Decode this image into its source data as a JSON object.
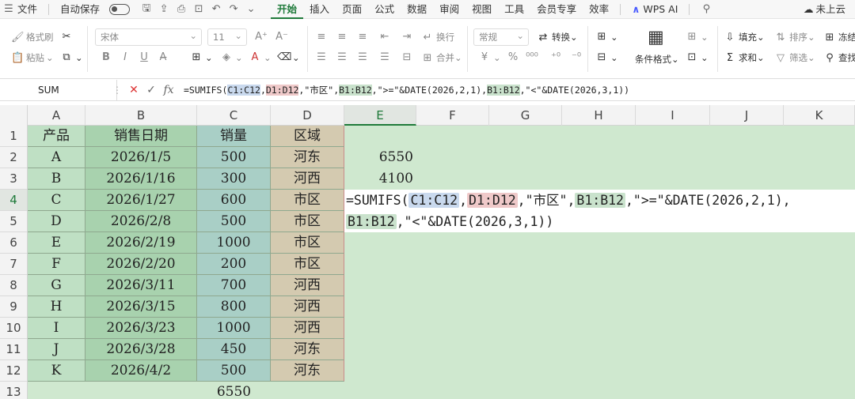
{
  "menubar": {
    "file": "文件",
    "autosave": "自动保存",
    "tabs": [
      "开始",
      "插入",
      "页面",
      "公式",
      "数据",
      "审阅",
      "视图",
      "工具",
      "会员专享",
      "效率"
    ],
    "active_tab": "开始",
    "wps_ai": "WPS AI",
    "cloud": "未上云"
  },
  "ribbon": {
    "format_painter": "格式刷",
    "paste": "粘贴",
    "font_name": "宋体",
    "font_size": "11",
    "wrap": "换行",
    "merge": "合并",
    "number_format": "常规",
    "convert": "转换",
    "conditional_format": "条件格式",
    "fill": "填充",
    "sort": "排序",
    "freeze": "冻结",
    "sum": "求和",
    "filter": "筛选",
    "find": "查找"
  },
  "formulabar": {
    "name_box": "SUM",
    "parts": [
      {
        "t": "=SUMIFS(",
        "c": ""
      },
      {
        "t": "C1:C12",
        "c": "r-c"
      },
      {
        "t": ",",
        "c": ""
      },
      {
        "t": "D1:D12",
        "c": "r-d"
      },
      {
        "t": ",\"市区\",",
        "c": ""
      },
      {
        "t": "B1:B12",
        "c": "r-b"
      },
      {
        "t": ",\">=\"&DATE(2026,2,1),",
        "c": ""
      },
      {
        "t": "B1:B12",
        "c": "r-b"
      },
      {
        "t": ",\"<\"&DATE(2026,3,1))",
        "c": ""
      }
    ]
  },
  "grid": {
    "columns": [
      "A",
      "B",
      "C",
      "D",
      "E",
      "F",
      "G",
      "H",
      "I",
      "J",
      "K"
    ],
    "rows": [
      "1",
      "2",
      "3",
      "4",
      "5",
      "6",
      "7",
      "8",
      "9",
      "10",
      "11",
      "12",
      "13"
    ],
    "header": [
      "产品",
      "销售日期",
      "销量",
      "区域"
    ],
    "data": [
      [
        "A",
        "2026/1/5",
        "500",
        "河东"
      ],
      [
        "B",
        "2026/1/16",
        "300",
        "河西"
      ],
      [
        "C",
        "2026/1/27",
        "600",
        "市区"
      ],
      [
        "D",
        "2026/2/8",
        "500",
        "市区"
      ],
      [
        "E",
        "2026/2/19",
        "1000",
        "市区"
      ],
      [
        "F",
        "2026/2/20",
        "200",
        "市区"
      ],
      [
        "G",
        "2026/3/11",
        "700",
        "河西"
      ],
      [
        "H",
        "2026/3/15",
        "800",
        "河西"
      ],
      [
        "I",
        "2026/3/23",
        "1000",
        "河西"
      ],
      [
        "J",
        "2026/3/28",
        "450",
        "河东"
      ],
      [
        "K",
        "2026/4/2",
        "500",
        "河东"
      ]
    ],
    "e2": "6550",
    "e3": "4100",
    "c13": "6550",
    "edit_line1": [
      {
        "t": "=SUMIFS(",
        "c": ""
      },
      {
        "t": "C1:C12",
        "c": "r-c"
      },
      {
        "t": ",",
        "c": ""
      },
      {
        "t": "D1:D12",
        "c": "r-d"
      },
      {
        "t": ",\"市区\",",
        "c": ""
      },
      {
        "t": "B1:B12",
        "c": "r-b"
      },
      {
        "t": ",\">=\"&DATE(2026,2,1),",
        "c": ""
      }
    ],
    "edit_line2": [
      {
        "t": "B1:B12",
        "c": "r-b"
      },
      {
        "t": ",\"<\"&DATE(2026,3,1))",
        "c": ""
      }
    ]
  }
}
